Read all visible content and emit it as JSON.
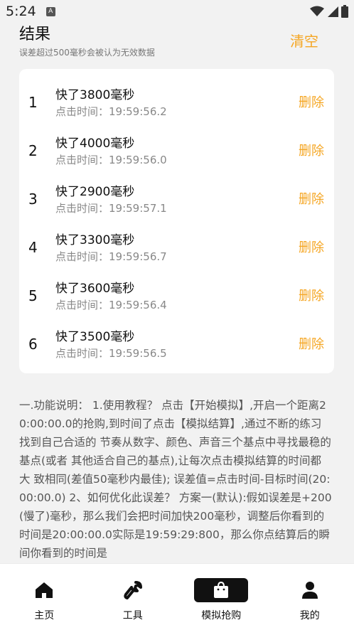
{
  "status_bar": {
    "time": "5:24",
    "notif_icon": "A"
  },
  "header": {
    "title": "结果",
    "subtitle": "误差超过500毫秒会被认为无效数据",
    "clear_label": "清空"
  },
  "colors": {
    "accent": "#f5a623",
    "text": "#111111",
    "muted": "#888888",
    "background": "#f2f2f2"
  },
  "results": [
    {
      "index": "1",
      "title": "快了3800毫秒",
      "click_time": "点击时间：19:59:56.2",
      "delete_label": "删除"
    },
    {
      "index": "2",
      "title": "快了4000毫秒",
      "click_time": "点击时间：19:59:56.0",
      "delete_label": "删除"
    },
    {
      "index": "3",
      "title": "快了2900毫秒",
      "click_time": "点击时间：19:59:57.1",
      "delete_label": "删除"
    },
    {
      "index": "4",
      "title": "快了3300毫秒",
      "click_time": "点击时间：19:59:56.7",
      "delete_label": "删除"
    },
    {
      "index": "5",
      "title": "快了3600毫秒",
      "click_time": "点击时间：19:59:56.4",
      "delete_label": "删除"
    },
    {
      "index": "6",
      "title": "快了3500毫秒",
      "click_time": "点击时间：19:59:56.5",
      "delete_label": "删除"
    }
  ],
  "description": "一.功能说明： 1.使用教程？ 点击【开始模拟】,开启一个距离20:00:00.0的抢购,到时间了点击【模拟结算】,通过不断的练习找到自己合适的 节奏从数字、颜色、声音三个基点中寻找最稳的基点(或者 其他适合自己的基点),让每次点击模拟结算的时间都大 致相同(差值50毫秒内最佳); 误差值=点击时间-目标时间(20:00:00.0) 2、如何优化此误差？ 方案一(默认):假如误差是+200(慢了)毫秒，那么我们会把时间加快200毫秒，调整后你看到的时间是20:00:00.0实际是19:59:29:800，那么你点结算后的瞬间你看到的时间是",
  "tabs": [
    {
      "label": "主页",
      "icon": "home-icon"
    },
    {
      "label": "工具",
      "icon": "wrench-icon"
    },
    {
      "label": "模拟抢购",
      "icon": "shopping-bag-icon",
      "active": true
    },
    {
      "label": "我的",
      "icon": "user-icon"
    }
  ]
}
